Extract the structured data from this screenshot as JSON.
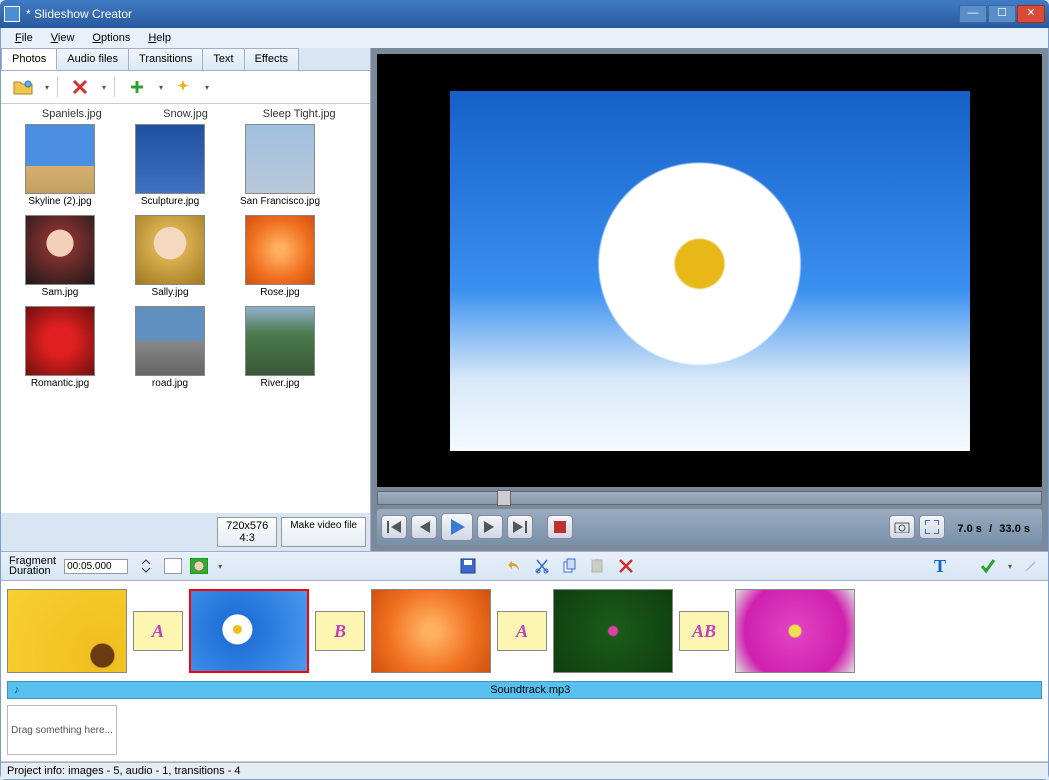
{
  "window": {
    "title": "* Slideshow Creator"
  },
  "menu": {
    "file": "File",
    "view": "View",
    "options": "Options",
    "help": "Help"
  },
  "tabs": {
    "photos": "Photos",
    "audio": "Audio files",
    "transitions": "Transitions",
    "text": "Text",
    "effects": "Effects"
  },
  "photo_header": {
    "a": "Spaniels.jpg",
    "b": "Snow.jpg",
    "c": "Sleep Tight.jpg"
  },
  "photos": {
    "r1": {
      "a": "Skyline (2).jpg",
      "b": "Sculpture.jpg",
      "c": "San Francisco.jpg"
    },
    "r2": {
      "a": "Sam.jpg",
      "b": "Sally.jpg",
      "c": "Rose.jpg"
    },
    "r3": {
      "a": "Romantic.jpg",
      "b": "road.jpg",
      "c": "River.jpg"
    }
  },
  "resolution": {
    "label": "720x576",
    "aspect": "4:3",
    "make": "Make video file"
  },
  "preview": {
    "time_current": "7.0 s",
    "time_sep": "/",
    "time_total": "33.0 s"
  },
  "timeline_toolbar": {
    "fragment_label1": "Fragment",
    "fragment_label2": "Duration",
    "fragment_value": "00:05.000"
  },
  "transitions": {
    "a": "A",
    "b": "B",
    "c": "A",
    "d": "AB"
  },
  "audio": {
    "note": "♪",
    "name": "Soundtrack.mp3"
  },
  "dropzone": {
    "text": "Drag something here..."
  },
  "status": {
    "text": "Project info: images - 5, audio - 1, transitions - 4"
  }
}
